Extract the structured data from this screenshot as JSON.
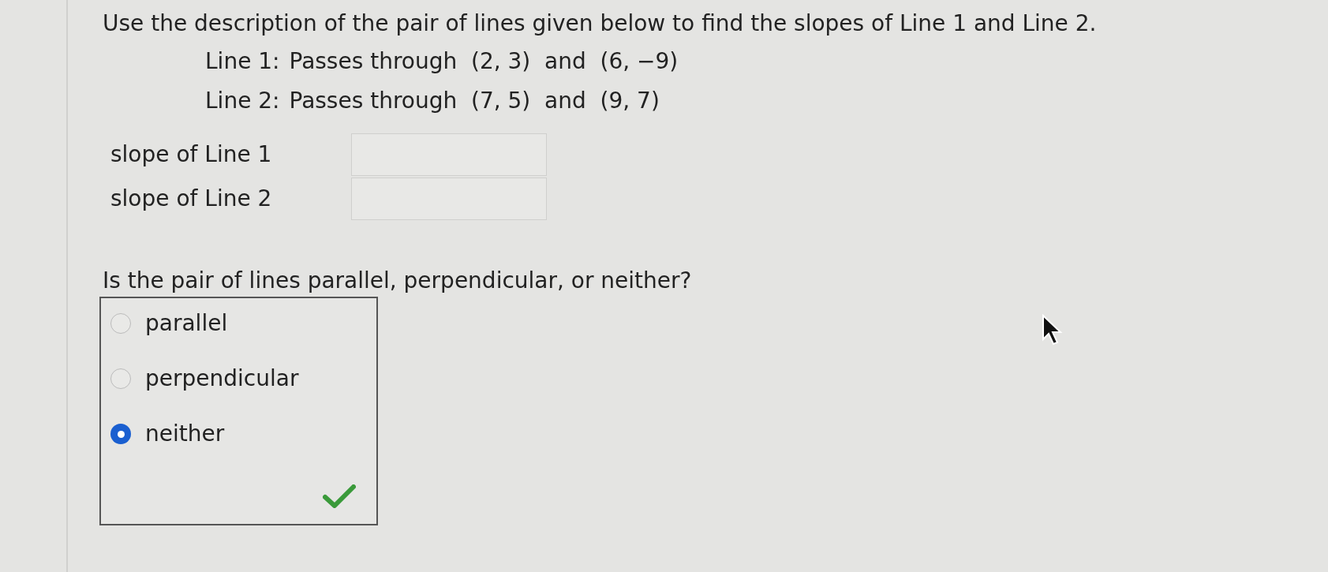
{
  "instruction": "Use the description of the pair of lines given below to find the slopes of Line 1 and Line 2.",
  "lines": [
    {
      "label": "Line 1:",
      "text": "Passes through  (2, 3)  and  (6, −9)"
    },
    {
      "label": "Line 2:",
      "text": "Passes through  (7, 5)  and  (9, 7)"
    }
  ],
  "slopes": [
    {
      "label": "slope of Line 1"
    },
    {
      "label": "slope of Line 2"
    }
  ],
  "question": "Is the pair of lines parallel, perpendicular, or neither?",
  "options": [
    {
      "label": "parallel",
      "selected": false
    },
    {
      "label": "perpendicular",
      "selected": false
    },
    {
      "label": "neither",
      "selected": true
    }
  ],
  "correct": true
}
